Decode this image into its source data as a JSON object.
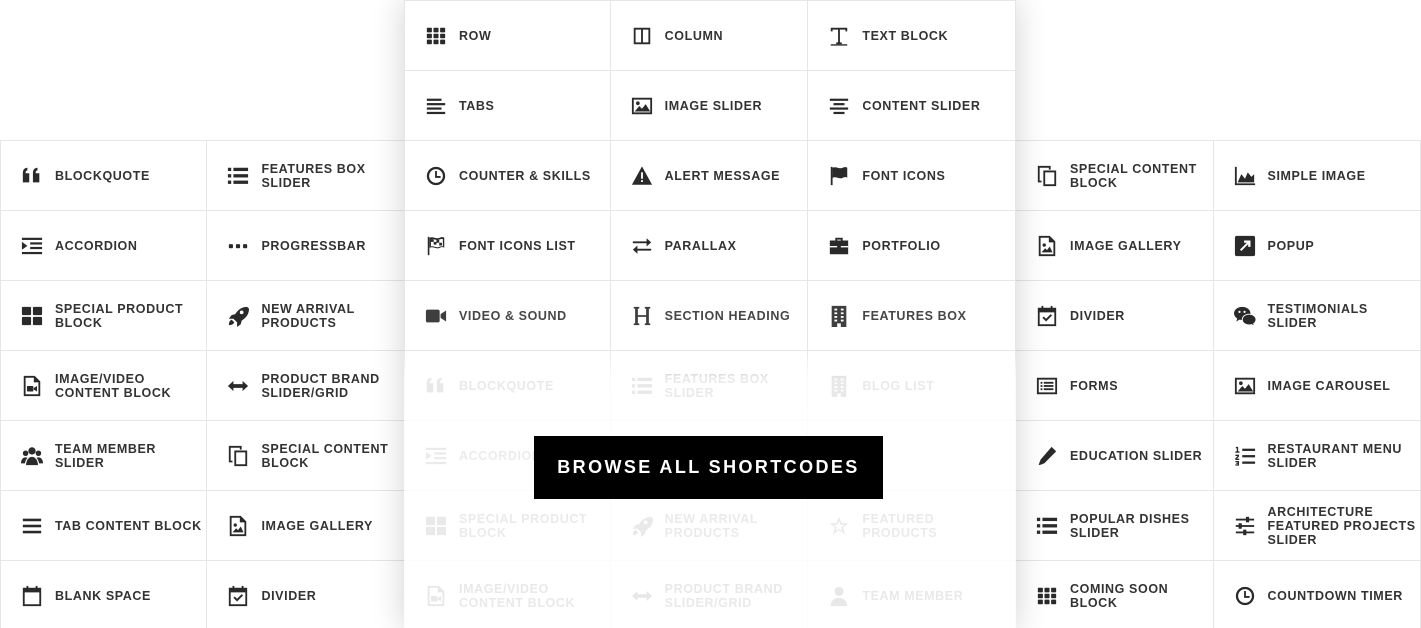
{
  "browse_button_label": "BROWSE ALL SHORTCODES",
  "grids": {
    "left": [
      [
        {
          "label": "BLOCKQUOTE",
          "icon": "quote-icon"
        },
        {
          "label": "FEATURES BOX SLIDER",
          "icon": "list-icon"
        }
      ],
      [
        {
          "label": "ACCORDION",
          "icon": "indent-icon"
        },
        {
          "label": "PROGRESSBAR",
          "icon": "dots-icon"
        }
      ],
      [
        {
          "label": "SPECIAL PRODUCT BLOCK",
          "icon": "dashboard-icon"
        },
        {
          "label": "NEW ARRIVAL PRODUCTS",
          "icon": "rocket-icon"
        }
      ],
      [
        {
          "label": "IMAGE/VIDEO CONTENT BLOCK",
          "icon": "video-file-icon"
        },
        {
          "label": "PRODUCT BRAND SLIDER/GRID",
          "icon": "arrows-horizontal-icon"
        }
      ],
      [
        {
          "label": "TEAM MEMBER SLIDER",
          "icon": "users-icon"
        },
        {
          "label": "SPECIAL CONTENT BLOCK",
          "icon": "copy-icon"
        }
      ],
      [
        {
          "label": "TAB CONTENT BLOCK",
          "icon": "menu-icon"
        },
        {
          "label": "IMAGE GALLERY",
          "icon": "image-file-icon"
        }
      ],
      [
        {
          "label": "BLANK SPACE",
          "icon": "calendar-icon"
        },
        {
          "label": "DIVIDER",
          "icon": "calendar-check-icon"
        }
      ]
    ],
    "middle": [
      [
        {
          "label": "ROW",
          "icon": "grid-icon"
        },
        {
          "label": "COLUMN",
          "icon": "columns-icon"
        },
        {
          "label": "TEXT BLOCK",
          "icon": "text-icon"
        }
      ],
      [
        {
          "label": "TABS",
          "icon": "align-left-icon"
        },
        {
          "label": "IMAGE SLIDER",
          "icon": "image-icon"
        },
        {
          "label": "CONTENT SLIDER",
          "icon": "align-center-icon"
        }
      ],
      [
        {
          "label": "COUNTER & SKILLS",
          "icon": "clock-icon"
        },
        {
          "label": "ALERT MESSAGE",
          "icon": "warning-icon"
        },
        {
          "label": "FONT ICONS",
          "icon": "flag-icon"
        }
      ],
      [
        {
          "label": "FONT ICONS LIST",
          "icon": "flag-checkered-icon"
        },
        {
          "label": "PARALLAX",
          "icon": "exchange-icon"
        },
        {
          "label": "PORTFOLIO",
          "icon": "briefcase-icon"
        }
      ],
      [
        {
          "label": "VIDEO & SOUND",
          "icon": "video-camera-icon"
        },
        {
          "label": "SECTION HEADING",
          "icon": "heading-icon"
        },
        {
          "label": "FEATURES BOX",
          "icon": "building-icon"
        }
      ],
      [
        {
          "label": "BLOCKQUOTE",
          "icon": "quote-icon"
        },
        {
          "label": "FEATURES BOX SLIDER",
          "icon": "list-icon"
        },
        {
          "label": "BLOG LIST",
          "icon": "building-icon"
        }
      ],
      [
        {
          "label": "ACCORDION",
          "icon": "indent-icon"
        },
        {
          "label": "",
          "icon": ""
        },
        {
          "label": "",
          "icon": ""
        }
      ],
      [
        {
          "label": "SPECIAL PRODUCT BLOCK",
          "icon": "dashboard-icon"
        },
        {
          "label": "NEW ARRIVAL PRODUCTS",
          "icon": "rocket-icon"
        },
        {
          "label": "FEATURED PRODUCTS",
          "icon": "star-icon"
        }
      ],
      [
        {
          "label": "IMAGE/VIDEO CONTENT BLOCK",
          "icon": "video-file-icon"
        },
        {
          "label": "PRODUCT BRAND SLIDER/GRID",
          "icon": "arrows-horizontal-icon"
        },
        {
          "label": "TEAM MEMBER",
          "icon": "user-icon"
        }
      ]
    ],
    "right": [
      [
        {
          "label": "SPECIAL CONTENT BLOCK",
          "icon": "copy-icon"
        },
        {
          "label": "SIMPLE IMAGE",
          "icon": "area-chart-icon"
        }
      ],
      [
        {
          "label": "IMAGE GALLERY",
          "icon": "image-file-icon"
        },
        {
          "label": "POPUP",
          "icon": "external-link-icon"
        }
      ],
      [
        {
          "label": "DIVIDER",
          "icon": "calendar-check-icon"
        },
        {
          "label": "TESTIMONIALS SLIDER",
          "icon": "chat-icon"
        }
      ],
      [
        {
          "label": "FORMS",
          "icon": "list-alt-icon"
        },
        {
          "label": "IMAGE CAROUSEL",
          "icon": "image-icon"
        }
      ],
      [
        {
          "label": "EDUCATION SLIDER",
          "icon": "pencil-icon"
        },
        {
          "label": "RESTAURANT MENU SLIDER",
          "icon": "list-ordered-icon"
        }
      ],
      [
        {
          "label": "POPULAR DISHES SLIDER",
          "icon": "list-icon"
        },
        {
          "label": "ARCHITECTURE FEATURED PROJECTS SLIDER",
          "icon": "sliders-icon"
        }
      ],
      [
        {
          "label": "COMING SOON BLOCK",
          "icon": "grid-icon"
        },
        {
          "label": "COUNTDOWN TIMER",
          "icon": "clock-icon"
        }
      ]
    ]
  }
}
